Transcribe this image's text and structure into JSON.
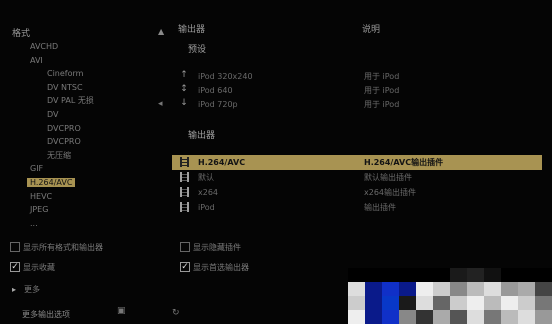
{
  "left_panel": {
    "header": "格式",
    "tree": [
      {
        "level": 0,
        "label": "AVCHD",
        "selected": false
      },
      {
        "level": 0,
        "label": "AVI",
        "selected": false
      },
      {
        "level": 1,
        "label": "Cineform",
        "selected": false
      },
      {
        "level": 1,
        "label": "DV NTSC",
        "selected": false
      },
      {
        "level": 1,
        "label": "DV PAL 无损",
        "selected": false
      },
      {
        "level": 1,
        "label": "DV",
        "selected": false
      },
      {
        "level": 1,
        "label": "DVCPRO",
        "selected": false
      },
      {
        "level": 1,
        "label": "DVCPRO",
        "selected": false
      },
      {
        "level": 1,
        "label": "无压缩",
        "selected": false
      },
      {
        "level": 0,
        "label": "GIF",
        "selected": false
      },
      {
        "level": 0,
        "label": "H.264/AVC",
        "selected": true
      },
      {
        "level": 0,
        "label": "HEVC",
        "selected": false
      },
      {
        "level": 0,
        "label": "JPEG",
        "selected": false
      },
      {
        "level": 0,
        "label": "...",
        "selected": false
      }
    ]
  },
  "right_panel": {
    "col_a_header": "输出器",
    "col_b_header": "说明",
    "presets_label": "预设",
    "presets": [
      {
        "name": "iPod 320x240",
        "desc": "用于 iPod"
      },
      {
        "name": "iPod 640",
        "desc": "用于 iPod"
      },
      {
        "name": "iPod 720p",
        "desc": "用于 iPod"
      }
    ],
    "exporters_label": "输出器",
    "exporters": [
      {
        "name": "H.264/AVC",
        "desc": "H.264/AVC输出插件",
        "selected": true
      },
      {
        "name": "默认",
        "desc": "默认输出插件",
        "selected": false
      },
      {
        "name": "x264",
        "desc": "x264输出插件",
        "selected": false
      },
      {
        "name": "iPod",
        "desc": "输出插件",
        "selected": false
      }
    ]
  },
  "options": {
    "opt_left_1": "显示所有格式和输出器",
    "opt_left_2": "显示收藏",
    "opt_right_1": "显示隐藏插件",
    "opt_right_2": "显示首选输出器",
    "more_label": "更多",
    "bottom_button": "更多输出选项"
  },
  "colors": {
    "highlight": "#a89352",
    "background": "#050505"
  }
}
